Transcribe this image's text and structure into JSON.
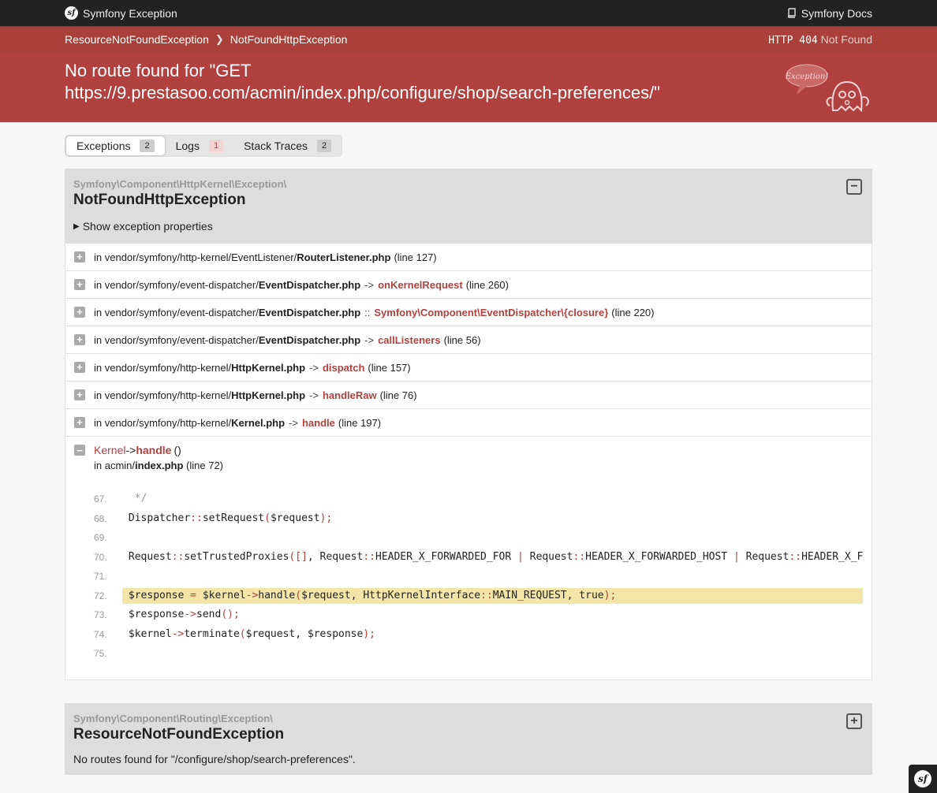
{
  "topbar": {
    "brand": "Symfony Exception",
    "docs": "Symfony Docs"
  },
  "crumbs": [
    "ResourceNotFoundException",
    "NotFoundHttpException"
  ],
  "status": {
    "code": "HTTP 404",
    "text": "Not Found"
  },
  "header": {
    "message": "No route found for \"GET https://9.prestasoo.com/acmin/index.php/configure/shop/search-preferences/\"",
    "ghost_text": "Exception!"
  },
  "tabs": [
    {
      "label": "Exceptions",
      "count": "2"
    },
    {
      "label": "Logs",
      "count": "1"
    },
    {
      "label": "Stack Traces",
      "count": "2"
    }
  ],
  "exception1": {
    "namespace": "Symfony\\Component\\HttpKernel\\Exception\\",
    "name": "NotFoundHttpException",
    "props_label": "Show exception properties",
    "trace": [
      {
        "prefix": "in vendor/symfony/http-kernel/EventListener/",
        "file": "RouterListener.php",
        "sep": "",
        "fn": "",
        "line": "(line 127)"
      },
      {
        "prefix": "in vendor/symfony/event-dispatcher/",
        "file": "EventDispatcher.php",
        "sep": "->",
        "fn": "onKernelRequest",
        "line": "(line 260)"
      },
      {
        "prefix": "in vendor/symfony/event-dispatcher/",
        "file": "EventDispatcher.php",
        "sep": "::",
        "fn": "Symfony\\Component\\EventDispatcher\\{closure}",
        "line": "(line 220)"
      },
      {
        "prefix": "in vendor/symfony/event-dispatcher/",
        "file": "EventDispatcher.php",
        "sep": "->",
        "fn": "callListeners",
        "line": "(line 56)"
      },
      {
        "prefix": "in vendor/symfony/http-kernel/",
        "file": "HttpKernel.php",
        "sep": "->",
        "fn": "dispatch",
        "line": "(line 157)"
      },
      {
        "prefix": "in vendor/symfony/http-kernel/",
        "file": "HttpKernel.php",
        "sep": "->",
        "fn": "handleRaw",
        "line": "(line 76)"
      },
      {
        "prefix": "in vendor/symfony/http-kernel/",
        "file": "Kernel.php",
        "sep": "->",
        "fn": "handle",
        "line": "(line 197)"
      }
    ],
    "expanded": {
      "cls": "Kernel",
      "arrow": "->",
      "fn": "handle",
      "parens": "()",
      "loc_prefix": "in acmin/",
      "loc_file": "index.php",
      "loc_line": "(line 72)"
    },
    "code": [
      {
        "no": "67.",
        "text": " */"
      },
      {
        "no": "68.",
        "text": "Dispatcher::setRequest($request);"
      },
      {
        "no": "69.",
        "text": ""
      },
      {
        "no": "70.",
        "text": "Request::setTrustedProxies([], Request::HEADER_X_FORWARDED_FOR | Request::HEADER_X_FORWARDED_HOST | Request::HEADER_X_FOR"
      },
      {
        "no": "71.",
        "text": ""
      },
      {
        "no": "72.",
        "text": "$response = $kernel->handle($request, HttpKernelInterface::MAIN_REQUEST, true);",
        "highlight": true
      },
      {
        "no": "73.",
        "text": "$response->send();"
      },
      {
        "no": "74.",
        "text": "$kernel->terminate($request, $response);"
      },
      {
        "no": "75.",
        "text": ""
      }
    ]
  },
  "exception2": {
    "namespace": "Symfony\\Component\\Routing\\Exception\\",
    "name": "ResourceNotFoundException",
    "message": "No routes found for \"/configure/shop/search-preferences\"."
  },
  "colors": {
    "accent": "#b0413e",
    "topbar": "#222222",
    "highlight": "#f4e6a8"
  },
  "icons": [
    "symfony-logo-icon",
    "book-icon",
    "chevron-right-icon",
    "ghost-icon",
    "collapse-icon",
    "expand-icon",
    "triangle-right-icon",
    "plus-box-icon",
    "minus-box-icon"
  ]
}
